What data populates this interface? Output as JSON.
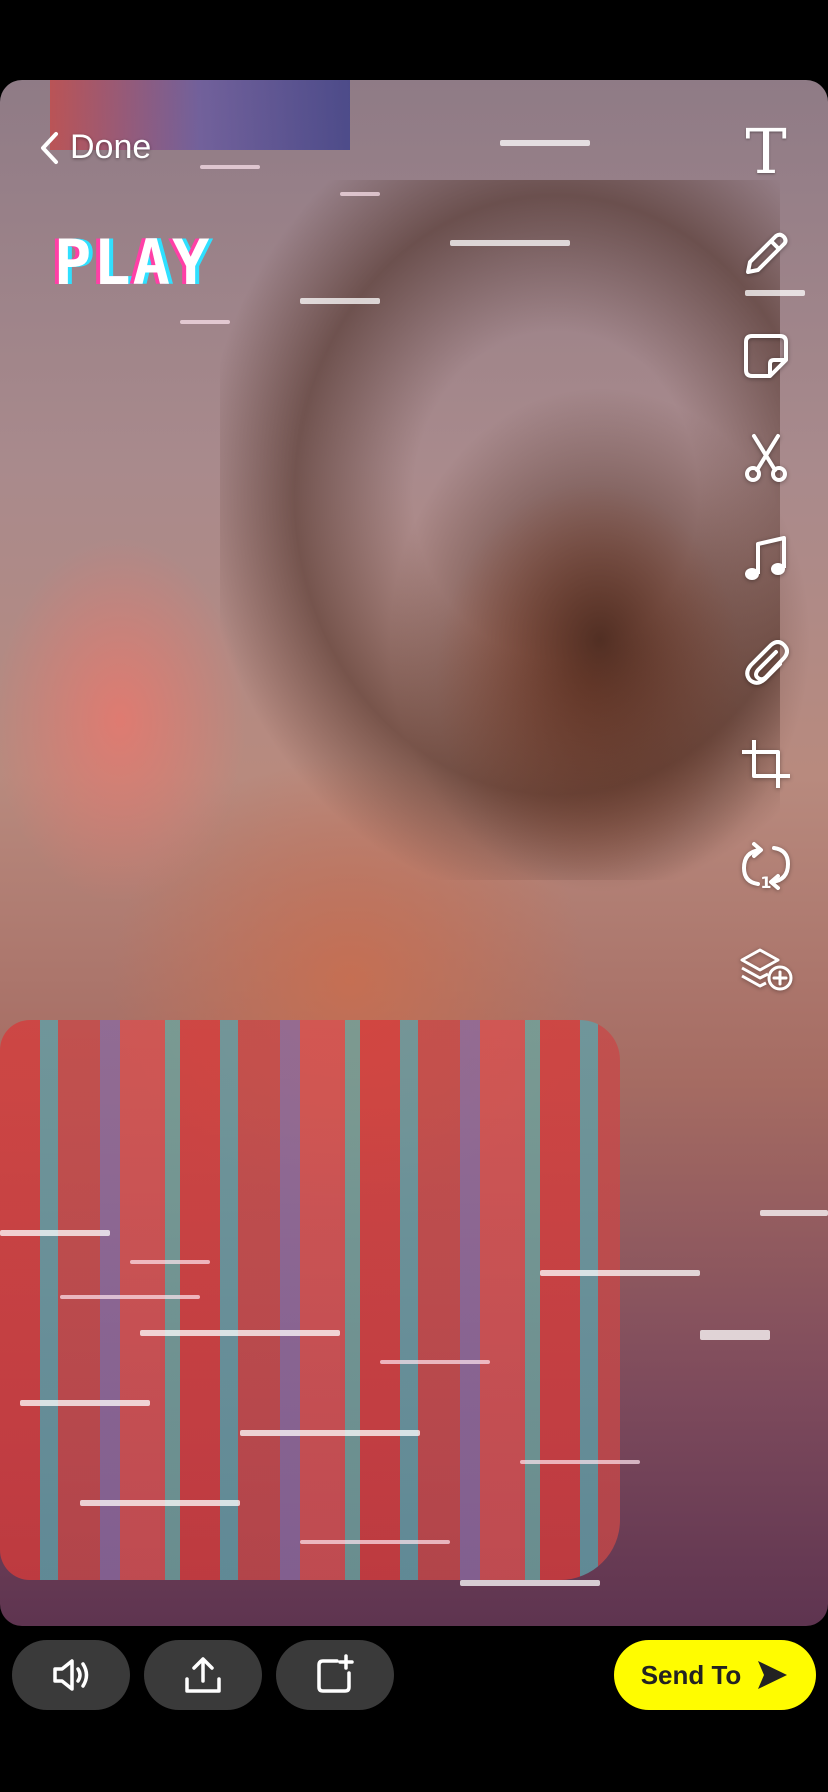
{
  "header": {
    "done_label": "Done"
  },
  "sticker": {
    "text": "PLAY"
  },
  "toolbar": {
    "text_tool_glyph": "T",
    "icons": [
      "text-icon",
      "pencil-icon",
      "sticker-icon",
      "scissors-icon",
      "music-icon",
      "paperclip-icon",
      "crop-icon",
      "loop-icon",
      "layers-add-icon"
    ]
  },
  "bottom": {
    "send_label": "Send To"
  },
  "colors": {
    "send_button": "#fffc00",
    "pill_bg": "#3a3a3a",
    "background": "#000000"
  }
}
